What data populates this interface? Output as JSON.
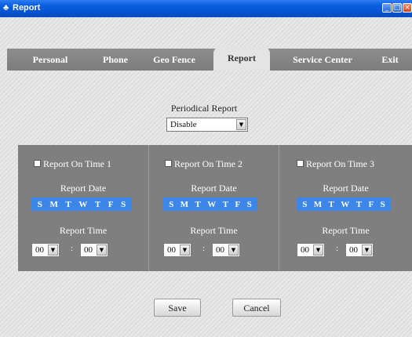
{
  "window": {
    "title": "Report"
  },
  "tabs": [
    {
      "label": "Personal",
      "active": false
    },
    {
      "label": "Phone",
      "active": false
    },
    {
      "label": "Geo Fence",
      "active": false
    },
    {
      "label": "Report",
      "active": true
    },
    {
      "label": "Service Center",
      "active": false
    },
    {
      "label": "Exit",
      "active": false
    }
  ],
  "periodical": {
    "label": "Periodical Report",
    "value": "Disable"
  },
  "panels": [
    {
      "checkbox_label": "Report On Time 1",
      "date_label": "Report Date",
      "days": [
        "S",
        "M",
        "T",
        "W",
        "T",
        "F",
        "S"
      ],
      "time_label": "Report Time",
      "hour": "00",
      "minute": "00",
      "sep": ":"
    },
    {
      "checkbox_label": "Report On Time 2",
      "date_label": "Report Date",
      "days": [
        "S",
        "M",
        "T",
        "W",
        "T",
        "F",
        "S"
      ],
      "time_label": "Report Time",
      "hour": "00",
      "minute": "00",
      "sep": ":"
    },
    {
      "checkbox_label": "Report On Time 3",
      "date_label": "Report Date",
      "days": [
        "S",
        "M",
        "T",
        "W",
        "T",
        "F",
        "S"
      ],
      "time_label": "Report Time",
      "hour": "00",
      "minute": "00",
      "sep": ":"
    }
  ],
  "buttons": {
    "save": "Save",
    "cancel": "Cancel"
  },
  "colors": {
    "titlebar": "#0a5fe0",
    "tabbar": "#808080",
    "panel": "#7f7f7f",
    "day_strip": "#3b86e8"
  }
}
